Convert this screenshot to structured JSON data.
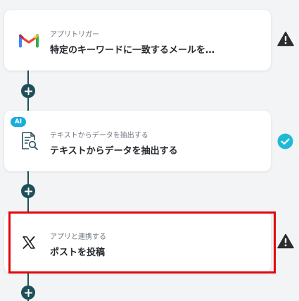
{
  "steps": [
    {
      "subtitle": "アプリトリガー",
      "title": "特定のキーワードに一致するメールを…",
      "app_icon": "gmail-icon",
      "status": "warning-icon"
    },
    {
      "subtitle": "テキストからデータを抽出する",
      "title": "テキストからデータを抽出する",
      "app_icon": "document-search-icon",
      "badge": "AI",
      "status": "check-icon"
    },
    {
      "subtitle": "アプリと連携する",
      "title": "ポストを投稿",
      "app_icon": "x-logo-icon",
      "status": "warning-icon",
      "selected": true
    }
  ],
  "colors": {
    "connector": "#1f4f59",
    "warning": "#2d2d2d",
    "success": "#1fb9d6",
    "ai_badge": "#19aeda",
    "selection": "#e0080c"
  }
}
